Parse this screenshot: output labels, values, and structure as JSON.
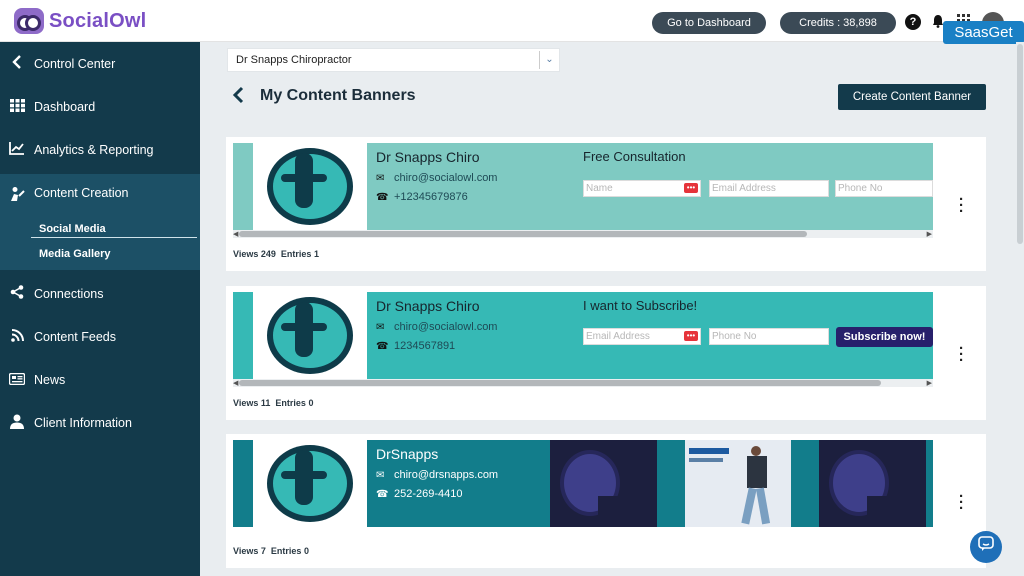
{
  "app": {
    "logo_text": "SocialOwl"
  },
  "topbar": {
    "dashboard_button": "Go to Dashboard",
    "credits": "Credits : 38,898",
    "help_icon": "?"
  },
  "overlay": {
    "watermark": "SaasGet"
  },
  "sidebar": {
    "items": [
      {
        "label": "Control Center",
        "icon": "chevron-left-icon"
      },
      {
        "label": "Dashboard",
        "icon": "grid-icon"
      },
      {
        "label": "Analytics & Reporting",
        "icon": "chart-icon"
      },
      {
        "label": "Content Creation",
        "icon": "create-icon",
        "active": true
      },
      {
        "label": "Connections",
        "icon": "share-icon"
      },
      {
        "label": "Content Feeds",
        "icon": "rss-icon"
      },
      {
        "label": "News",
        "icon": "news-icon"
      },
      {
        "label": "Client Information",
        "icon": "user-icon"
      }
    ],
    "subitems": [
      {
        "label": "Social Media",
        "active": true
      },
      {
        "label": "Media Gallery"
      }
    ]
  },
  "main": {
    "client_select": "Dr Snapps Chiropractor",
    "page_title": "My Content Banners",
    "create_button": "Create Content Banner"
  },
  "banners": [
    {
      "name": "Dr Snapps Chiro",
      "email": "chiro@socialowl.com",
      "phone": "+12345679876",
      "form_title": "Free Consultation",
      "fields": [
        "Name",
        "Email Address",
        "Phone No"
      ],
      "views_label": "Views",
      "views": "249",
      "entries_label": "Entries",
      "entries": "1",
      "bg_color": "#7fcac2"
    },
    {
      "name": "Dr Snapps Chiro",
      "email": "chiro@socialowl.com",
      "phone": "1234567891",
      "form_title": "I want to Subscribe!",
      "fields": [
        "Email Address",
        "Phone No"
      ],
      "submit_button": "Subscribe now!",
      "views_label": "Views",
      "views": "11",
      "entries_label": "Entries",
      "entries": "0",
      "bg_color": "#36b9b5"
    },
    {
      "name": "DrSnapps",
      "email": "chiro@drsnapps.com",
      "phone": "252-269-4410",
      "views_label": "Views",
      "views": "7",
      "entries_label": "Entries",
      "entries": "0",
      "bg_color": "#127d8b"
    }
  ]
}
